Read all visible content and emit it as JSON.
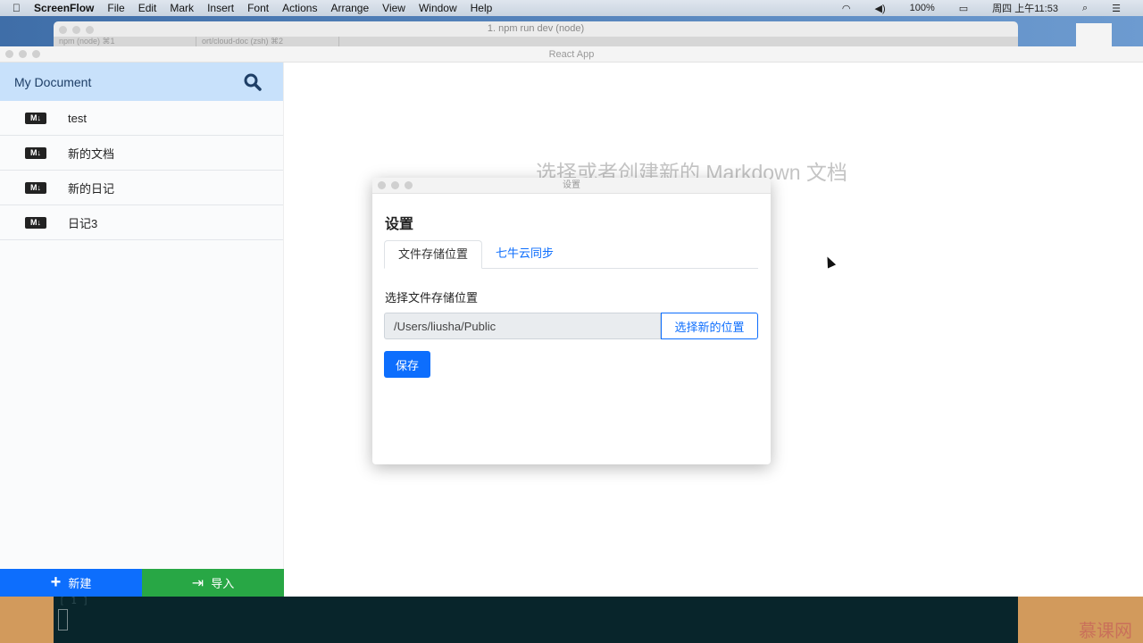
{
  "menubar": {
    "app": "ScreenFlow",
    "items": [
      "File",
      "Edit",
      "Mark",
      "Insert",
      "Font",
      "Actions",
      "Arrange",
      "View",
      "Window",
      "Help"
    ],
    "battery": "100%",
    "clock": "周四 上午11:53"
  },
  "terminal": {
    "title": "1. npm run dev (node)",
    "tabs": [
      "npm (node)  ⌘1",
      "ort/cloud-doc (zsh)  ⌘2"
    ],
    "prompt": "[ 1 ]"
  },
  "window": {
    "title": "React App"
  },
  "sidebar": {
    "title": "My Document",
    "files": [
      {
        "icon": "MD↓",
        "name": "test"
      },
      {
        "icon": "MD↓",
        "name": "新的文档"
      },
      {
        "icon": "MD↓",
        "name": "新的日记"
      },
      {
        "icon": "MD↓",
        "name": "日记3"
      }
    ],
    "new_label": "新建",
    "import_label": "导入"
  },
  "main": {
    "empty_text": "选择或者创建新的 Markdown 文档"
  },
  "dialog": {
    "window_title": "设置",
    "heading": "设置",
    "tabs": [
      "文件存储位置",
      "七牛云同步"
    ],
    "field_label": "选择文件存储位置",
    "path_value": "/Users/liusha/Public",
    "choose_label": "选择新的位置",
    "save_label": "保存"
  },
  "watermark": "慕课网",
  "colors": {
    "primary": "#0d6efd",
    "import": "#28a745",
    "sidebar_header": "#c8e1fb"
  }
}
